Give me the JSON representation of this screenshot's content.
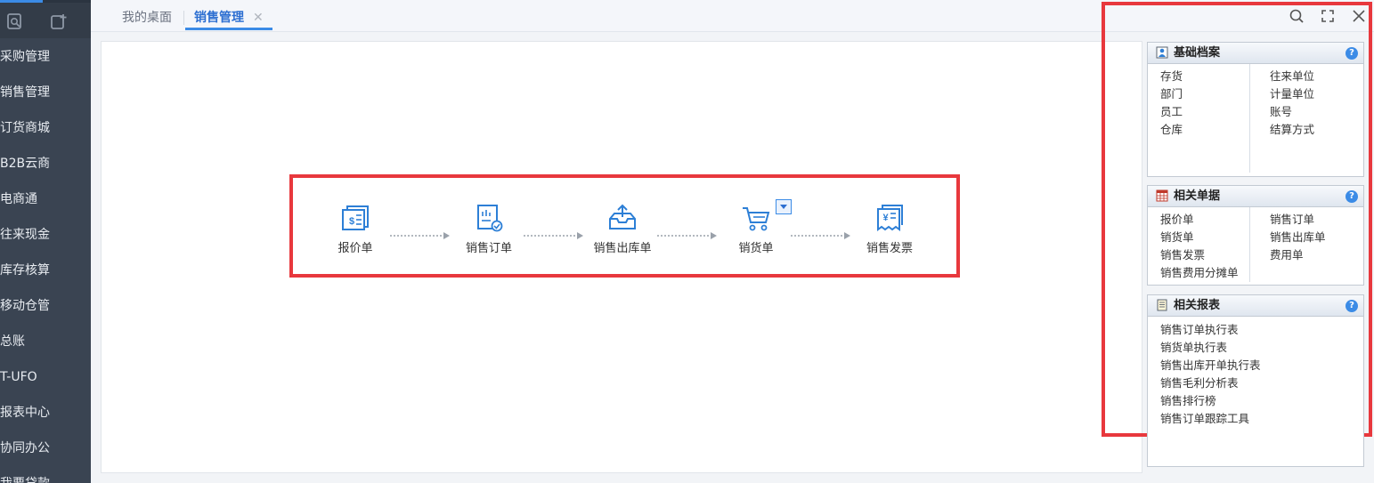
{
  "sidebar": {
    "items": [
      {
        "label": "采购管理"
      },
      {
        "label": "销售管理"
      },
      {
        "label": "订货商城"
      },
      {
        "label": "B2B云商"
      },
      {
        "label": "电商通"
      },
      {
        "label": "往来现金"
      },
      {
        "label": "库存核算"
      },
      {
        "label": "移动仓管"
      },
      {
        "label": "总账"
      },
      {
        "label": "T-UFO"
      },
      {
        "label": "报表中心"
      },
      {
        "label": "协同办公"
      },
      {
        "label": "我要贷款"
      }
    ],
    "top_icons": [
      "search-doc-icon",
      "add-doc-icon"
    ]
  },
  "tabs": [
    {
      "label": "我的桌面"
    },
    {
      "label": "销售管理",
      "close": "✕"
    }
  ],
  "toolbar_icons": [
    "search-icon",
    "fullscreen-icon",
    "close-icon"
  ],
  "flow": {
    "nodes": [
      {
        "label": "报价单",
        "icon": "quote-icon"
      },
      {
        "label": "销售订单",
        "icon": "sales-order-icon"
      },
      {
        "label": "销售出库单",
        "icon": "outbound-icon"
      },
      {
        "label": "销货单",
        "icon": "cart-icon"
      },
      {
        "label": "销售发票",
        "icon": "invoice-icon"
      }
    ]
  },
  "panels": {
    "basic": {
      "title": "基础档案",
      "help": "?",
      "left": [
        "存货",
        "部门",
        "员工",
        "仓库"
      ],
      "right": [
        "往来单位",
        "计量单位",
        "账号",
        "结算方式"
      ]
    },
    "docs": {
      "title": "相关单据",
      "help": "?",
      "left": [
        "报价单",
        "销货单",
        "销售发票",
        "销售费用分摊单"
      ],
      "right": [
        "销售订单",
        "销售出库单",
        "费用单"
      ]
    },
    "reports": {
      "title": "相关报表",
      "help": "?",
      "items": [
        "销售订单执行表",
        "销货单执行表",
        "销售出库开单执行表",
        "销售毛利分析表",
        "销售排行榜",
        "销售订单跟踪工具"
      ]
    }
  },
  "colors": {
    "sidebar_bg": "#3a4452",
    "accent": "#3b8be6",
    "highlight_border": "#e8383d",
    "icon_blue": "#2d7fd6"
  }
}
